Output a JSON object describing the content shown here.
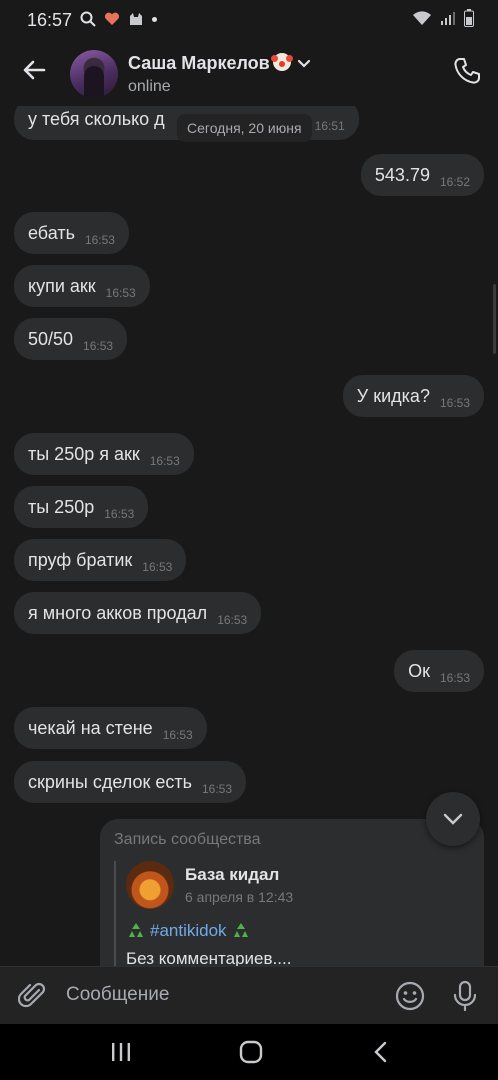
{
  "statusbar": {
    "time": "16:57"
  },
  "header": {
    "name": "Саша Маркелов",
    "status": "online"
  },
  "date_chip": "Сегодня, 20 июня",
  "messages": [
    {
      "side": "in",
      "text": "у тебя сколько д",
      "time": "16:51"
    },
    {
      "side": "out",
      "text": "543.79",
      "time": "16:52"
    },
    {
      "side": "in",
      "text": "ебать",
      "time": "16:53"
    },
    {
      "side": "in",
      "text": "купи акк",
      "time": "16:53"
    },
    {
      "side": "in",
      "text": "50/50",
      "time": "16:53"
    },
    {
      "side": "out",
      "text": "У кидка?",
      "time": "16:53"
    },
    {
      "side": "in",
      "text": "ты 250р я акк",
      "time": "16:53"
    },
    {
      "side": "in",
      "text": "ты 250р",
      "time": "16:53"
    },
    {
      "side": "in",
      "text": "пруф братик",
      "time": "16:53"
    },
    {
      "side": "in",
      "text": "я много акков продал",
      "time": "16:53"
    },
    {
      "side": "out",
      "text": "Ок",
      "time": "16:53"
    },
    {
      "side": "in",
      "text": "чекай на стене",
      "time": "16:53"
    },
    {
      "side": "in",
      "text": "скрины сделок есть",
      "time": "16:53"
    }
  ],
  "repost": {
    "label": "Запись сообщества",
    "group_name": "База кидал",
    "date": "6 апреля в 12:43",
    "hashtag": "#antikidok",
    "text": "Без комментариев...."
  },
  "composer": {
    "placeholder": "Сообщение"
  },
  "colors": {
    "bg": "#191919",
    "bubble": "#2c2d2e",
    "link": "#71aaeb",
    "muted": "#76787a"
  }
}
